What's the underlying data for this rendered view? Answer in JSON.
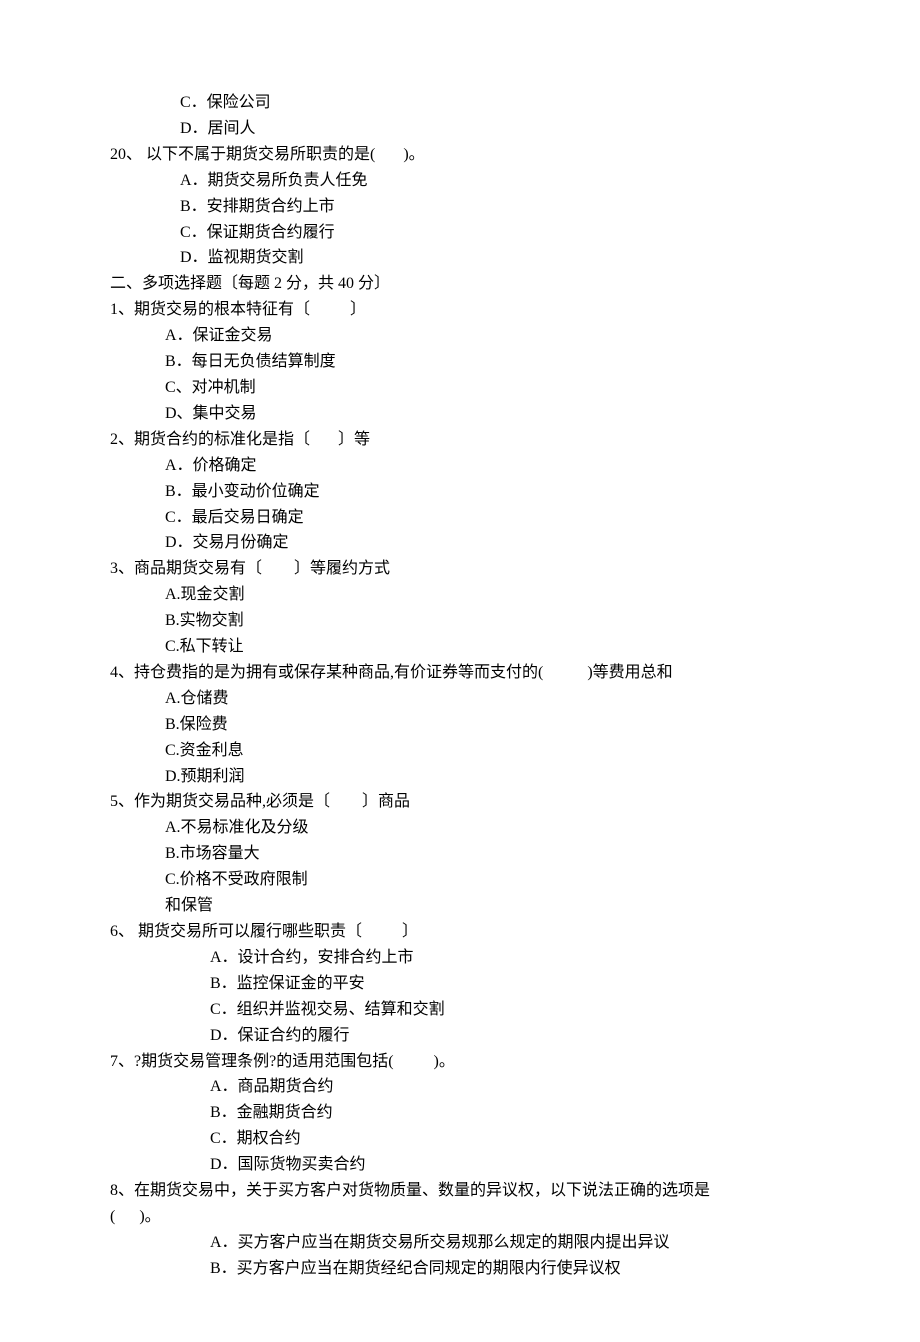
{
  "pre_options": {
    "c": "C．保险公司",
    "d": "D．居间人"
  },
  "q20": {
    "stem": "20、 以下不属于期货交易所职责的是(       )。",
    "a": "A．期货交易所负责人任免",
    "b": "B．安排期货合约上市",
    "c": "C．保证期货合约履行",
    "d": "D．监视期货交割"
  },
  "section2_heading": "二、多项选择题〔每题 2 分，共 40 分〕",
  "m1": {
    "stem": "1、期货交易的根本特征有〔          〕",
    "a": "A．保证金交易",
    "b": "B．每日无负债结算制度",
    "c": "C、对冲机制",
    "d": "D、集中交易"
  },
  "m2": {
    "stem": "2、期货合约的标准化是指〔       〕等",
    "a": "A．价格确定",
    "b": "B．最小变动价位确定",
    "c": "C．最后交易日确定",
    "d": "D．交易月份确定"
  },
  "m3": {
    "stem": "3、商品期货交易有〔        〕等履约方式",
    "a": "A.现金交割",
    "b": "B.实物交割",
    "c": "C.私下转让"
  },
  "m4": {
    "stem": "4、持仓费指的是为拥有或保存某种商品,有价证券等而支付的(           )等费用总和",
    "a": "A.仓储费",
    "b": "B.保险费",
    "c": "C.资金利息",
    "d": "D.预期利润"
  },
  "m5": {
    "stem": "5、作为期货交易品种,必须是〔        〕商品",
    "a": "A.不易标准化及分级",
    "b": "B.市场容量大",
    "c": "C.价格不受政府限制",
    "extra": "和保管"
  },
  "m6": {
    "stem": "6、 期货交易所可以履行哪些职责〔          〕",
    "a": "A．设计合约，安排合约上市",
    "b": "B．监控保证金的平安",
    "c": "C．组织并监视交易、结算和交割",
    "d": "D．保证合约的履行"
  },
  "m7": {
    "stem": "7、?期货交易管理条例?的适用范围包括(          )。",
    "a": "A．商品期货合约",
    "b": "B．金融期货合约",
    "c": "C．期权合约",
    "d": "D．国际货物买卖合约"
  },
  "m8": {
    "stem_line1": "8、在期货交易中，关于买方客户对货物质量、数量的异议权，以下说法正确的选项是",
    "stem_line2": "(      )。",
    "a": "A．买方客户应当在期货交易所交易规那么规定的期限内提出异议",
    "b": "B．买方客户应当在期货经纪合同规定的期限内行使异议权"
  }
}
